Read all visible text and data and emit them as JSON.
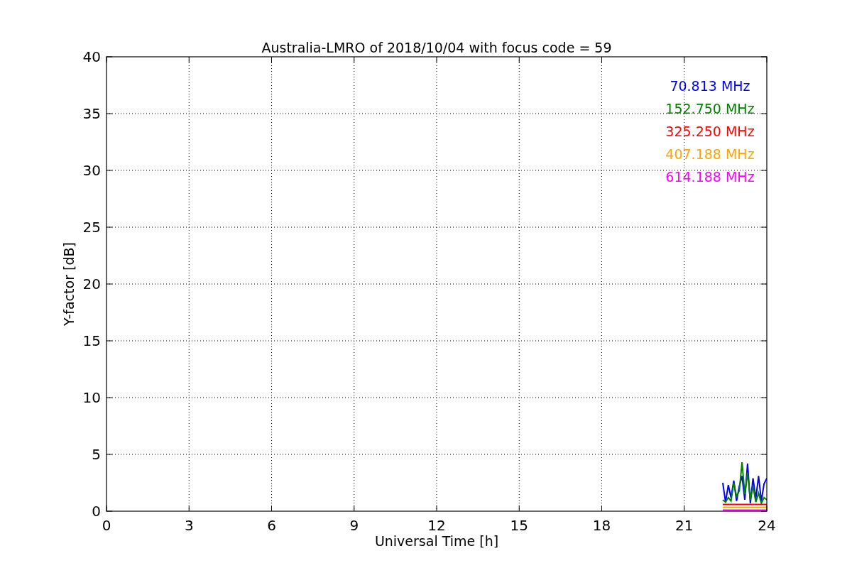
{
  "figure": {
    "chart_data": {
      "type": "line",
      "grid": true,
      "title": "Australia-LMRO of 2018/10/04 with focus code = 59",
      "xlabel": "Universal Time [h]",
      "ylabel": "Y-factor [dB]",
      "xlim": [
        0,
        24
      ],
      "ylim": [
        0,
        40
      ],
      "xticks": [
        0,
        3,
        6,
        9,
        12,
        15,
        18,
        21,
        24
      ],
      "yticks": [
        0,
        5,
        10,
        15,
        20,
        25,
        30,
        35,
        40
      ],
      "x": [
        22.4,
        22.5,
        22.6,
        22.7,
        22.8,
        22.9,
        23.0,
        23.1,
        23.2,
        23.3,
        23.4,
        23.5,
        23.6,
        23.7,
        23.8,
        23.9,
        24.0
      ],
      "series": [
        {
          "name": "70.813 MHz",
          "color": "#0000ff",
          "values": [
            2.5,
            0.8,
            2.3,
            1.2,
            2.7,
            0.9,
            2.2,
            3.1,
            1.0,
            4.2,
            0.7,
            2.9,
            1.1,
            3.1,
            0.9,
            2.4,
            2.9
          ]
        },
        {
          "name": "152.750 MHz",
          "color": "#008000",
          "values": [
            1.0,
            0.8,
            1.2,
            0.9,
            2.5,
            1.3,
            1.8,
            4.3,
            1.5,
            3.4,
            1.0,
            2.2,
            0.8,
            1.6,
            0.7,
            1.2,
            1.0
          ]
        },
        {
          "name": "325.250 MHz",
          "color": "#ff0000",
          "values": [
            0.6,
            0.6,
            0.6,
            0.6,
            0.6,
            0.6,
            0.6,
            0.6,
            0.6,
            0.6,
            0.6,
            0.6,
            0.6,
            0.6,
            0.6,
            0.6,
            0.6
          ]
        },
        {
          "name": "407.188 MHz",
          "color": "#ffa500",
          "values": [
            0.35,
            0.35,
            0.35,
            0.35,
            0.35,
            0.35,
            0.35,
            0.35,
            0.35,
            0.35,
            0.35,
            0.35,
            0.35,
            0.35,
            0.35,
            0.35,
            0.35
          ]
        },
        {
          "name": "614.188 MHz",
          "color": "#ff00ff",
          "values": [
            0.1,
            0.1,
            0.1,
            0.1,
            0.1,
            0.1,
            0.1,
            0.1,
            0.1,
            0.1,
            0.1,
            0.1,
            0.1,
            0.1,
            0.1,
            0.1,
            0.1
          ]
        }
      ]
    }
  }
}
